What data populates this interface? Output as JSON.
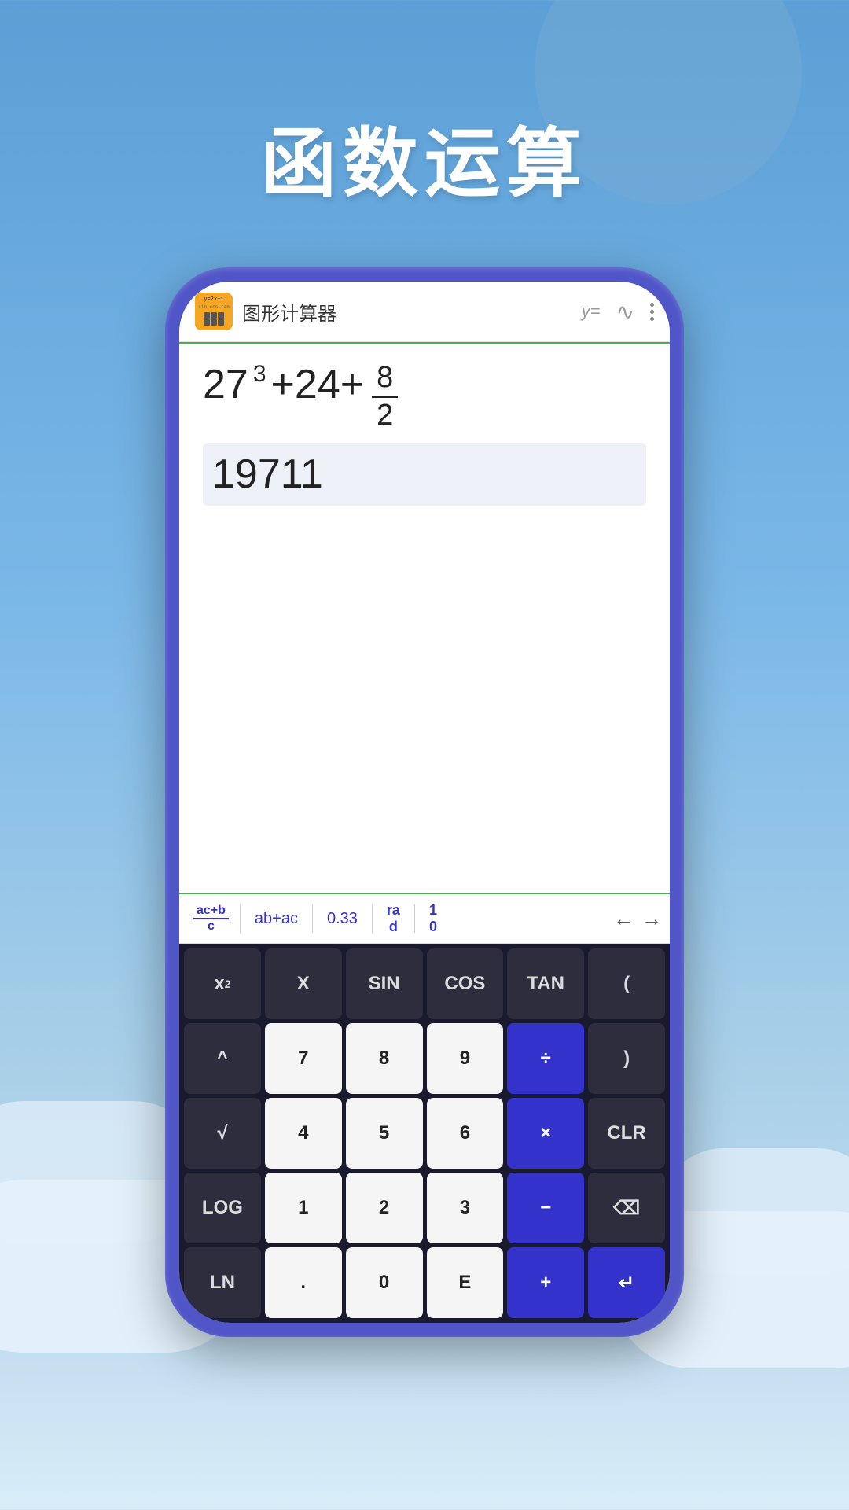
{
  "background": {
    "gradient_start": "#5b9fd6",
    "gradient_end": "#d8edf8"
  },
  "title": {
    "text": "函数运算",
    "color": "#ffffff"
  },
  "header": {
    "app_icon_label": "图形计算器 icon",
    "app_name": "图形计算器",
    "icon_formula": "y=",
    "icon_wave": "∿",
    "more_icon": "⋮"
  },
  "display": {
    "expression": "27³+24+8/2",
    "expression_parts": {
      "base": "27",
      "exponent": "3",
      "plus1": "+24+",
      "frac_num": "8",
      "frac_den": "2"
    },
    "result": "19711"
  },
  "toolbar": {
    "items": [
      {
        "label": "ac+b",
        "sublabel": "c",
        "type": "fraction",
        "id": "frac-btn"
      },
      {
        "label": "ab+ac",
        "type": "text",
        "id": "factor-btn"
      },
      {
        "label": "0.33",
        "type": "text",
        "id": "decimal-btn"
      },
      {
        "label": "ra",
        "sublabel": "d",
        "type": "stacked",
        "id": "rad-btn"
      },
      {
        "label": "1",
        "sublabel": "0",
        "type": "stacked",
        "id": "ten-btn"
      }
    ],
    "nav_left": "←",
    "nav_right": "→"
  },
  "keyboard": {
    "rows": [
      [
        {
          "label": "x²",
          "style": "dark",
          "id": "x-squared"
        },
        {
          "label": "X",
          "style": "dark",
          "id": "x-var"
        },
        {
          "label": "SIN",
          "style": "dark",
          "id": "sin"
        },
        {
          "label": "COS",
          "style": "dark",
          "id": "cos"
        },
        {
          "label": "TAN",
          "style": "dark",
          "id": "tan"
        },
        {
          "label": "(",
          "style": "dark",
          "id": "open-paren"
        }
      ],
      [
        {
          "label": "^",
          "style": "dark",
          "id": "power"
        },
        {
          "label": "7",
          "style": "light",
          "id": "seven"
        },
        {
          "label": "8",
          "style": "light",
          "id": "eight"
        },
        {
          "label": "9",
          "style": "light",
          "id": "nine"
        },
        {
          "label": "÷",
          "style": "blue",
          "id": "divide"
        },
        {
          "label": ")",
          "style": "dark",
          "id": "close-paren"
        }
      ],
      [
        {
          "label": "√",
          "style": "dark",
          "id": "sqrt"
        },
        {
          "label": "4",
          "style": "light",
          "id": "four"
        },
        {
          "label": "5",
          "style": "light",
          "id": "five"
        },
        {
          "label": "6",
          "style": "light",
          "id": "six"
        },
        {
          "label": "×",
          "style": "blue",
          "id": "multiply"
        },
        {
          "label": "CLR",
          "style": "dark",
          "id": "clr"
        }
      ],
      [
        {
          "label": "LOG",
          "style": "dark",
          "id": "log"
        },
        {
          "label": "1",
          "style": "light",
          "id": "one"
        },
        {
          "label": "2",
          "style": "light",
          "id": "two"
        },
        {
          "label": "3",
          "style": "light",
          "id": "three"
        },
        {
          "label": "−",
          "style": "blue",
          "id": "subtract"
        },
        {
          "label": "⌫",
          "style": "backspace",
          "id": "backspace"
        }
      ],
      [
        {
          "label": "LN",
          "style": "dark",
          "id": "ln"
        },
        {
          "label": ".",
          "style": "light",
          "id": "dot"
        },
        {
          "label": "0",
          "style": "light",
          "id": "zero"
        },
        {
          "label": "E",
          "style": "light",
          "id": "euler"
        },
        {
          "label": "+",
          "style": "blue",
          "id": "add"
        },
        {
          "label": "↵",
          "style": "blue",
          "id": "enter"
        }
      ]
    ]
  }
}
